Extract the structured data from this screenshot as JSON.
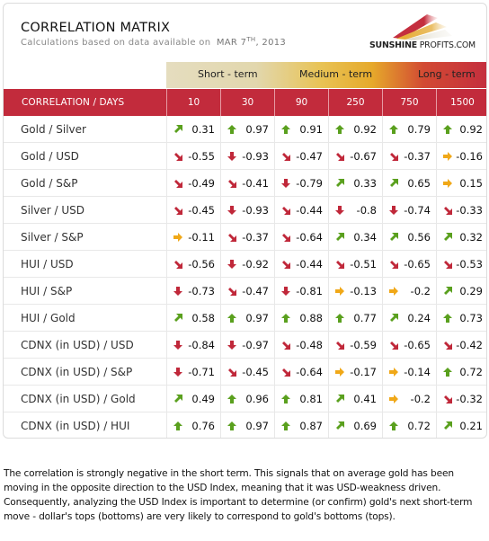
{
  "header": {
    "title": "CORRELATION MATRIX",
    "subtitle": "Calculations based on data available on",
    "date_main": "MAR 7",
    "date_sup": "TH",
    "date_year": ", 2013",
    "logo_bold": "SUNSHINE",
    "logo_thin": " PROFITS.COM"
  },
  "terms": [
    "Short - term",
    "Medium - term",
    "Long - term"
  ],
  "table": {
    "corner_label": "CORRELATION / DAYS",
    "columns": [
      "10",
      "30",
      "90",
      "250",
      "750",
      "1500"
    ],
    "rows": [
      {
        "label": "Gold / Silver",
        "cells": [
          {
            "value": "0.31",
            "trend": "up-right"
          },
          {
            "value": "0.97",
            "trend": "up"
          },
          {
            "value": "0.91",
            "trend": "up"
          },
          {
            "value": "0.92",
            "trend": "up"
          },
          {
            "value": "0.79",
            "trend": "up"
          },
          {
            "value": "0.92",
            "trend": "up"
          }
        ]
      },
      {
        "label": "Gold / USD",
        "cells": [
          {
            "value": "-0.55",
            "trend": "down-right"
          },
          {
            "value": "-0.93",
            "trend": "down"
          },
          {
            "value": "-0.47",
            "trend": "down-right"
          },
          {
            "value": "-0.67",
            "trend": "down-right"
          },
          {
            "value": "-0.37",
            "trend": "down-right"
          },
          {
            "value": "-0.16",
            "trend": "right"
          }
        ]
      },
      {
        "label": "Gold / S&P",
        "cells": [
          {
            "value": "-0.49",
            "trend": "down-right"
          },
          {
            "value": "-0.41",
            "trend": "down-right"
          },
          {
            "value": "-0.79",
            "trend": "down"
          },
          {
            "value": "0.33",
            "trend": "up-right"
          },
          {
            "value": "0.65",
            "trend": "up-right"
          },
          {
            "value": "0.15",
            "trend": "right"
          }
        ]
      },
      {
        "label": "Silver / USD",
        "cells": [
          {
            "value": "-0.45",
            "trend": "down-right"
          },
          {
            "value": "-0.93",
            "trend": "down"
          },
          {
            "value": "-0.44",
            "trend": "down-right"
          },
          {
            "value": "-0.8",
            "trend": "down"
          },
          {
            "value": "-0.74",
            "trend": "down"
          },
          {
            "value": "-0.33",
            "trend": "down-right"
          }
        ]
      },
      {
        "label": "Silver / S&P",
        "cells": [
          {
            "value": "-0.11",
            "trend": "right"
          },
          {
            "value": "-0.37",
            "trend": "down-right"
          },
          {
            "value": "-0.64",
            "trend": "down-right"
          },
          {
            "value": "0.34",
            "trend": "up-right"
          },
          {
            "value": "0.56",
            "trend": "up-right"
          },
          {
            "value": "0.32",
            "trend": "up-right"
          }
        ]
      },
      {
        "label": "HUI / USD",
        "cells": [
          {
            "value": "-0.56",
            "trend": "down-right"
          },
          {
            "value": "-0.92",
            "trend": "down"
          },
          {
            "value": "-0.44",
            "trend": "down-right"
          },
          {
            "value": "-0.51",
            "trend": "down-right"
          },
          {
            "value": "-0.65",
            "trend": "down-right"
          },
          {
            "value": "-0.53",
            "trend": "down-right"
          }
        ]
      },
      {
        "label": "HUI / S&P",
        "cells": [
          {
            "value": "-0.73",
            "trend": "down"
          },
          {
            "value": "-0.47",
            "trend": "down-right"
          },
          {
            "value": "-0.81",
            "trend": "down"
          },
          {
            "value": "-0.13",
            "trend": "right"
          },
          {
            "value": "-0.2",
            "trend": "right"
          },
          {
            "value": "0.29",
            "trend": "up-right"
          }
        ]
      },
      {
        "label": "HUI / Gold",
        "cells": [
          {
            "value": "0.58",
            "trend": "up-right"
          },
          {
            "value": "0.97",
            "trend": "up"
          },
          {
            "value": "0.88",
            "trend": "up"
          },
          {
            "value": "0.77",
            "trend": "up"
          },
          {
            "value": "0.24",
            "trend": "up-right"
          },
          {
            "value": "0.73",
            "trend": "up"
          }
        ]
      },
      {
        "label": "CDNX (in USD) / USD",
        "cells": [
          {
            "value": "-0.84",
            "trend": "down"
          },
          {
            "value": "-0.97",
            "trend": "down"
          },
          {
            "value": "-0.48",
            "trend": "down-right"
          },
          {
            "value": "-0.59",
            "trend": "down-right"
          },
          {
            "value": "-0.65",
            "trend": "down-right"
          },
          {
            "value": "-0.42",
            "trend": "down-right"
          }
        ]
      },
      {
        "label": "CDNX (in USD) / S&P",
        "cells": [
          {
            "value": "-0.71",
            "trend": "down"
          },
          {
            "value": "-0.45",
            "trend": "down-right"
          },
          {
            "value": "-0.64",
            "trend": "down-right"
          },
          {
            "value": "-0.17",
            "trend": "right"
          },
          {
            "value": "-0.14",
            "trend": "right"
          },
          {
            "value": "0.72",
            "trend": "up"
          }
        ]
      },
      {
        "label": "CDNX (in USD) / Gold",
        "cells": [
          {
            "value": "0.49",
            "trend": "up-right"
          },
          {
            "value": "0.96",
            "trend": "up"
          },
          {
            "value": "0.81",
            "trend": "up"
          },
          {
            "value": "0.41",
            "trend": "up-right"
          },
          {
            "value": "-0.2",
            "trend": "right"
          },
          {
            "value": "-0.32",
            "trend": "down-right"
          }
        ]
      },
      {
        "label": "CDNX (in USD) / HUI",
        "cells": [
          {
            "value": "0.76",
            "trend": "up"
          },
          {
            "value": "0.97",
            "trend": "up"
          },
          {
            "value": "0.87",
            "trend": "up"
          },
          {
            "value": "0.69",
            "trend": "up-right"
          },
          {
            "value": "0.72",
            "trend": "up"
          },
          {
            "value": "0.21",
            "trend": "up-right"
          }
        ]
      }
    ]
  },
  "colors": {
    "header_red": "#c22b3c",
    "arrow_green": "#5aa01e",
    "arrow_red": "#c0283a",
    "arrow_orange": "#f0a818"
  },
  "note": "The correlation is strongly negative in the short term. This signals that on average gold has been moving in the opposite direction to the USD Index, meaning that it was USD-weakness driven. Consequently, analyzing the USD Index is important to determine (or confirm) gold's next short-term move - dollar's tops (bottoms) are very likely to correspond to gold's bottoms (tops)."
}
